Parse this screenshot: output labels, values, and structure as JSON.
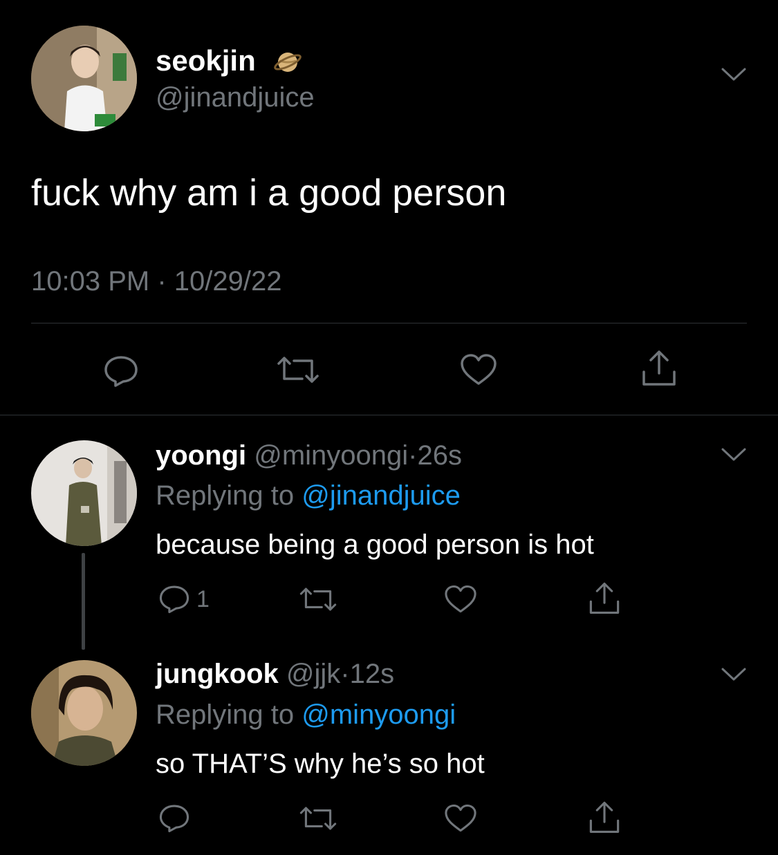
{
  "main_tweet": {
    "display_name": "seokjin",
    "badge_icon": "planet-emoji-icon",
    "handle": "@jinandjuice",
    "text": "fuck why am i a good person",
    "time": "10:03 PM",
    "separator": "·",
    "date": "10/29/22"
  },
  "replies": [
    {
      "display_name": "yoongi",
      "handle": "@minyoongi",
      "separator": "·",
      "age": "26s",
      "replying_prefix": "Replying to",
      "replying_to": "@jinandjuice",
      "text": "because being a good person is hot",
      "reply_count": "1"
    },
    {
      "display_name": "jungkook",
      "handle": "@jjk",
      "separator": "·",
      "age": "12s",
      "replying_prefix": "Replying to",
      "replying_to": "@minyoongi",
      "text": "so THAT’S why he’s so hot",
      "reply_count": ""
    }
  ],
  "colors": {
    "background": "#000000",
    "text": "#e7e9ea",
    "muted": "#71767b",
    "link": "#1d9bf0",
    "divider": "#2f3336"
  },
  "icons": [
    "chevron-down-icon",
    "reply-icon",
    "retweet-icon",
    "like-icon",
    "share-icon"
  ]
}
